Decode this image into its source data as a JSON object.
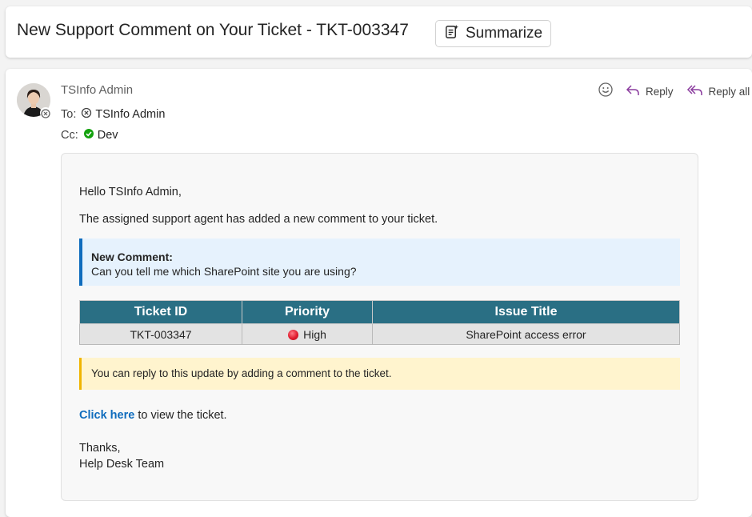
{
  "subject": "New Support Comment on Your Ticket - TKT-003347",
  "summarize_label": "Summarize",
  "sender": {
    "name": "TSInfo Admin"
  },
  "to": {
    "label": "To:",
    "name": "TSInfo Admin"
  },
  "cc": {
    "label": "Cc:",
    "name": "Dev"
  },
  "actions": {
    "reply": "Reply",
    "reply_all": "Reply all"
  },
  "body": {
    "greeting": "Hello TSInfo Admin,",
    "intro": "The assigned support agent has added a new comment to your ticket.",
    "comment_heading": "New Comment:",
    "comment_text": "Can you tell me which SharePoint site you are using?",
    "table": {
      "headers": [
        "Ticket ID",
        "Priority",
        "Issue Title"
      ],
      "rows": [
        [
          "TKT-003347",
          "High",
          "SharePoint access error"
        ]
      ]
    },
    "note": "You can reply to this update by adding a comment to the ticket.",
    "link_text": "Click here",
    "link_suffix": " to view the ticket.",
    "closing": "Thanks,",
    "signature": "Help Desk Team"
  },
  "colors": {
    "table_header": "#2a6f84",
    "comment_border": "#0f6cbd",
    "note_border": "#f0b400",
    "priority_high": "#e01c2e",
    "presence_available": "#13a10e"
  }
}
